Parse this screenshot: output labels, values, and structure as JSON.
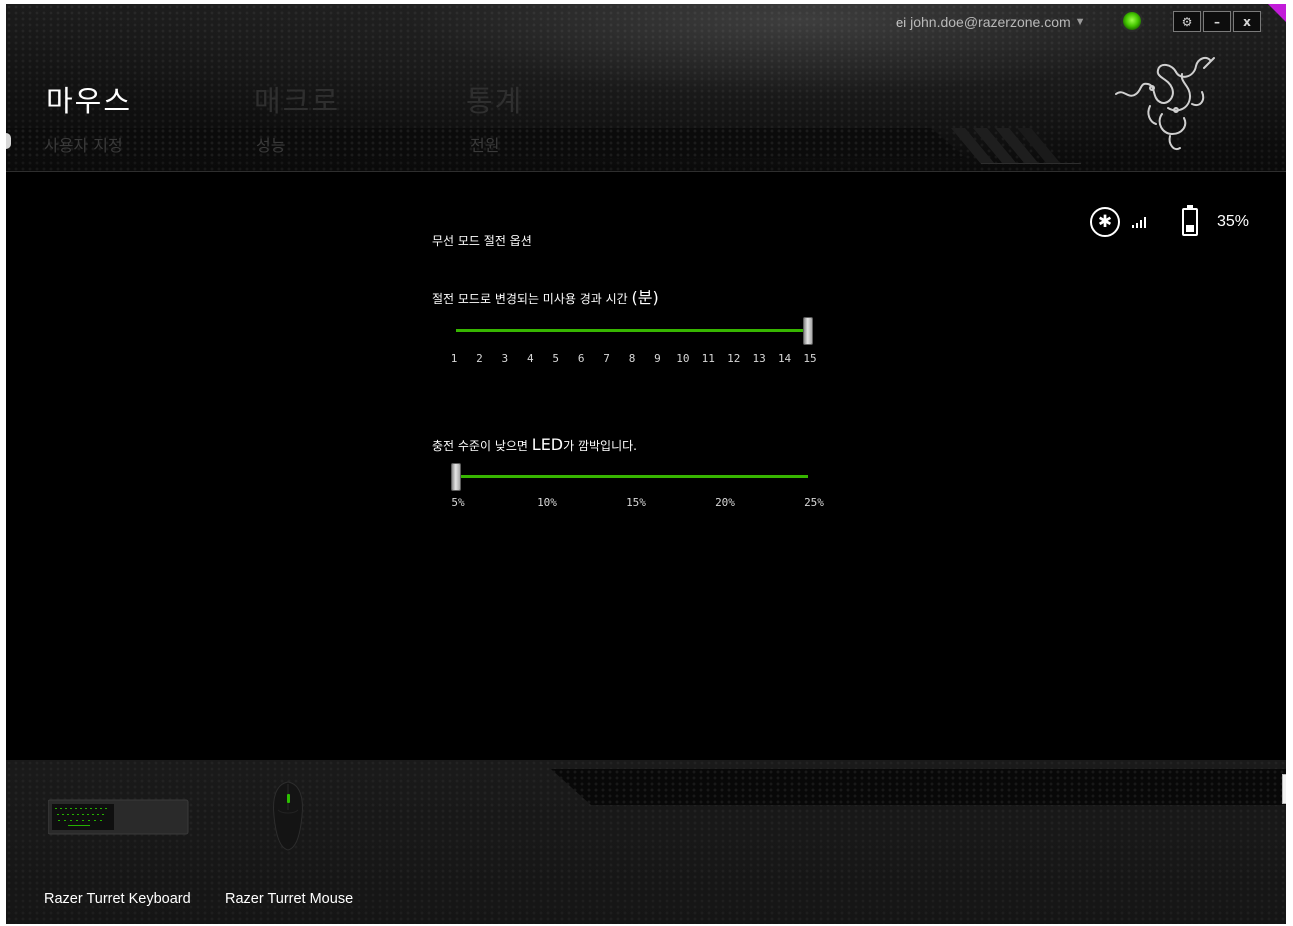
{
  "account": {
    "email": "john.doe@razerzone.com",
    "user_icon": "user-icon",
    "status": "online",
    "status_color": "#44c600"
  },
  "window_buttons": {
    "settings": "⚙",
    "minimize": "–",
    "close": "x"
  },
  "main_tabs": [
    {
      "label": "마우스",
      "active": true
    },
    {
      "label": "매크로",
      "active": false
    },
    {
      "label": "통계",
      "active": false
    }
  ],
  "sub_tabs": [
    {
      "label": "사용자 지정",
      "active": false
    },
    {
      "label": "성능",
      "active": false
    },
    {
      "label": "전원",
      "active": true
    }
  ],
  "device_status": {
    "bluetooth_icon": "bluetooth-icon",
    "signal_icon": "signal-strength-icon",
    "battery_icon": "battery-icon",
    "battery_level": 0.35,
    "battery_text": "35%"
  },
  "power": {
    "section_title": "무선 모드 절전 옵션",
    "sleep_label": "절전 모드로 변경되는 미사용 경과 시간",
    "sleep_unit": "(분)",
    "sleep_ticks": [
      "1",
      "2",
      "3",
      "4",
      "5",
      "6",
      "7",
      "8",
      "9",
      "10",
      "11",
      "12",
      "13",
      "14",
      "15"
    ],
    "sleep_value": 15,
    "led_label_pre": "충전 수준이 낮으면",
    "led_label_big": "LED",
    "led_label_post": "가 깜박입니다.",
    "led_ticks": [
      "5%",
      "10%",
      "15%",
      "20%",
      "25%"
    ],
    "led_value": "5%"
  },
  "devices": [
    {
      "name": "Razer Turret Keyboard",
      "icon": "keyboard-icon"
    },
    {
      "name": "Razer Turret Mouse",
      "icon": "mouse-icon"
    }
  ],
  "colors": {
    "accent_green": "#37b500",
    "background": "#000000"
  }
}
